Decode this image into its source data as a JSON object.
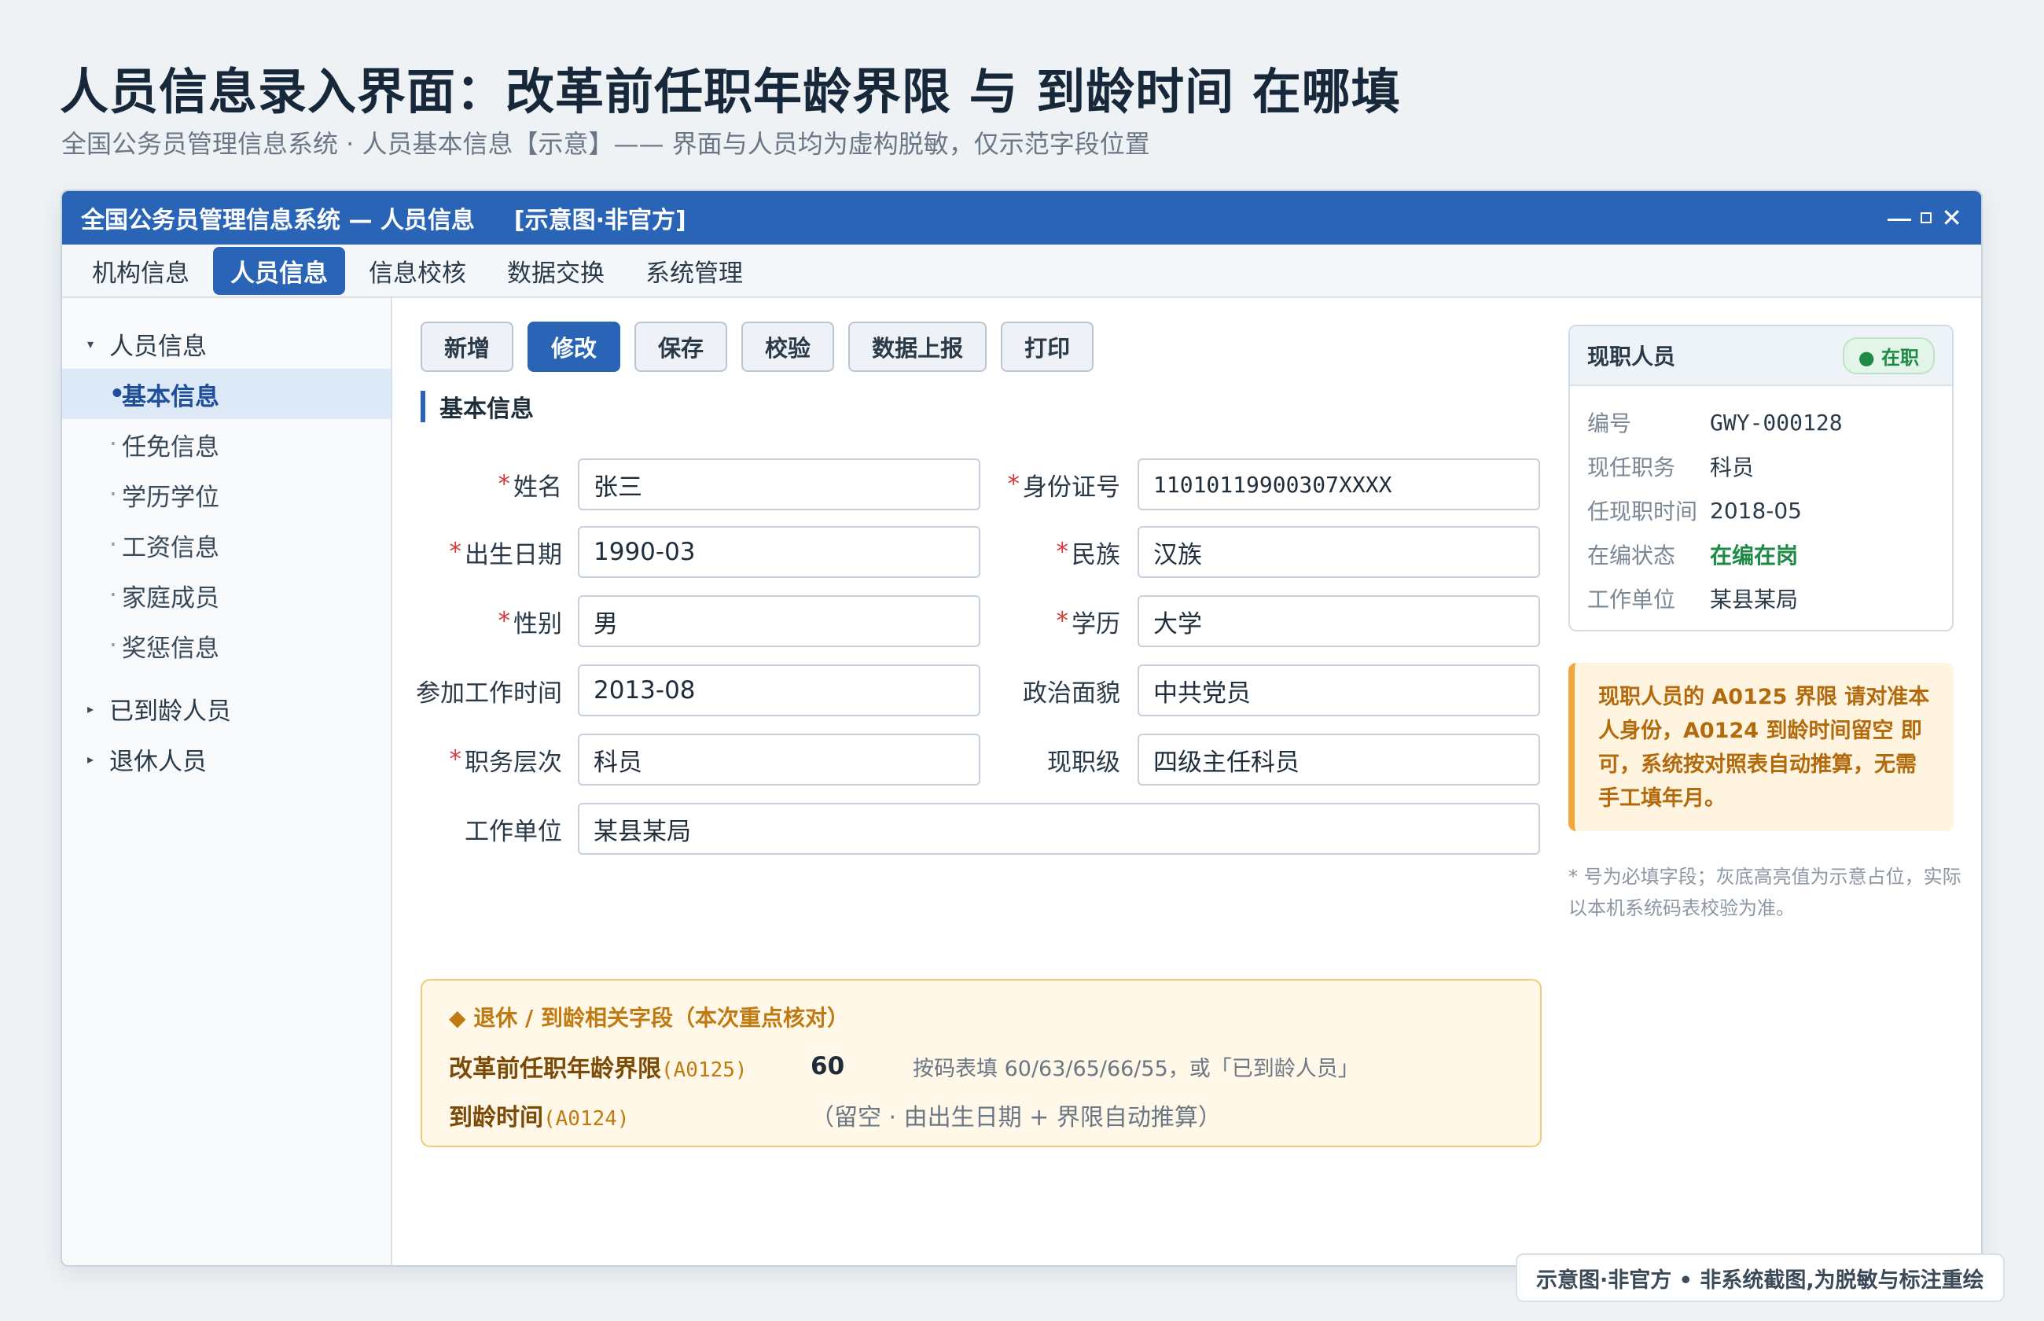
{
  "page": {
    "title": "人员信息录入界面：改革前任职年龄界限 与 到龄时间 在哪填",
    "subtitle": "全国公务员管理信息系统 · 人员基本信息【示意】—— 界面与人员均为虚构脱敏，仅示范字段位置"
  },
  "window": {
    "title": "全国公务员管理信息系统 — 人员信息",
    "tag": "[示意图·非官方]",
    "controls": {
      "minimize": "—",
      "maximize": "□",
      "close": "✕"
    }
  },
  "menu": [
    {
      "label": "机构信息",
      "active": false
    },
    {
      "label": "人员信息",
      "active": true
    },
    {
      "label": "信息校核",
      "active": false
    },
    {
      "label": "数据交换",
      "active": false
    },
    {
      "label": "系统管理",
      "active": false
    }
  ],
  "sidebar": {
    "group1": {
      "caret": "▾",
      "label": "人员信息"
    },
    "children": [
      "基本信息",
      "任免信息",
      "学历学位",
      "工资信息",
      "家庭成员",
      "奖惩信息"
    ],
    "active_child": "基本信息",
    "group2": {
      "caret": "▸",
      "label": "已到龄人员"
    },
    "group3": {
      "caret": "▸",
      "label": "退休人员"
    },
    "child_dot": "·",
    "active_dot": "•"
  },
  "toolbar": [
    "新增",
    "修改",
    "保存",
    "校验",
    "数据上报",
    "打印"
  ],
  "section_title": "基本信息",
  "required_mark": "*",
  "form": {
    "name": {
      "label": "姓名",
      "value": "张三"
    },
    "id_number": {
      "label": "身份证号",
      "value": "11010119900307XXXX"
    },
    "birth": {
      "label": "出生日期",
      "value": "1990-03"
    },
    "ethnicity": {
      "label": "民族",
      "value": "汉族"
    },
    "gender": {
      "label": "性别",
      "value": "男"
    },
    "education": {
      "label": "学历",
      "value": "大学"
    },
    "work_start": {
      "label": "参加工作时间",
      "value": "2013-08"
    },
    "political": {
      "label": "政治面貌",
      "value": "中共党员"
    },
    "post_level": {
      "label": "职务层次",
      "value": "科员"
    },
    "rank": {
      "label": "现职级",
      "value": "四级主任科员"
    },
    "unit": {
      "label": "工作单位",
      "value": "某县某局"
    }
  },
  "retire": {
    "title": "◆ 退休 / 到龄相关字段（本次重点核对）",
    "age_limit": {
      "label": "改革前任职年龄界限",
      "code": "(A0125)",
      "value": "60",
      "hint": "按码表填 60/63/65/66/55，或「已到龄人员」"
    },
    "due_time": {
      "label": "到龄时间",
      "code": "(A0124)",
      "hint": "（留空 · 由出生日期 + 界限自动推算）"
    }
  },
  "card": {
    "title": "现职人员",
    "badge": "● 在职",
    "rows": [
      {
        "k": "编号",
        "v": "GWY-000128"
      },
      {
        "k": "现任职务",
        "v": "科员"
      },
      {
        "k": "任现职时间",
        "v": "2018-05"
      },
      {
        "k": "在编状态",
        "v": "在编在岗"
      },
      {
        "k": "工作单位",
        "v": "某县某局"
      }
    ]
  },
  "note": "现职人员的 A0125 界限 请对准本人身份，A0124 到龄时间留空 即可，系统按对照表自动推算，无需手工填年月。",
  "footnote": "* 号为必填字段；灰底高亮值为示意占位，实际以本机系统码表校验为准。",
  "disclaimer": "示意图·非官方 • 非系统截图,为脱敏与标注重绘",
  "colors": {
    "brand": "#2a64b6",
    "required": "#d23b3b",
    "warning": "#f0a83a",
    "success": "#1f8a45"
  }
}
